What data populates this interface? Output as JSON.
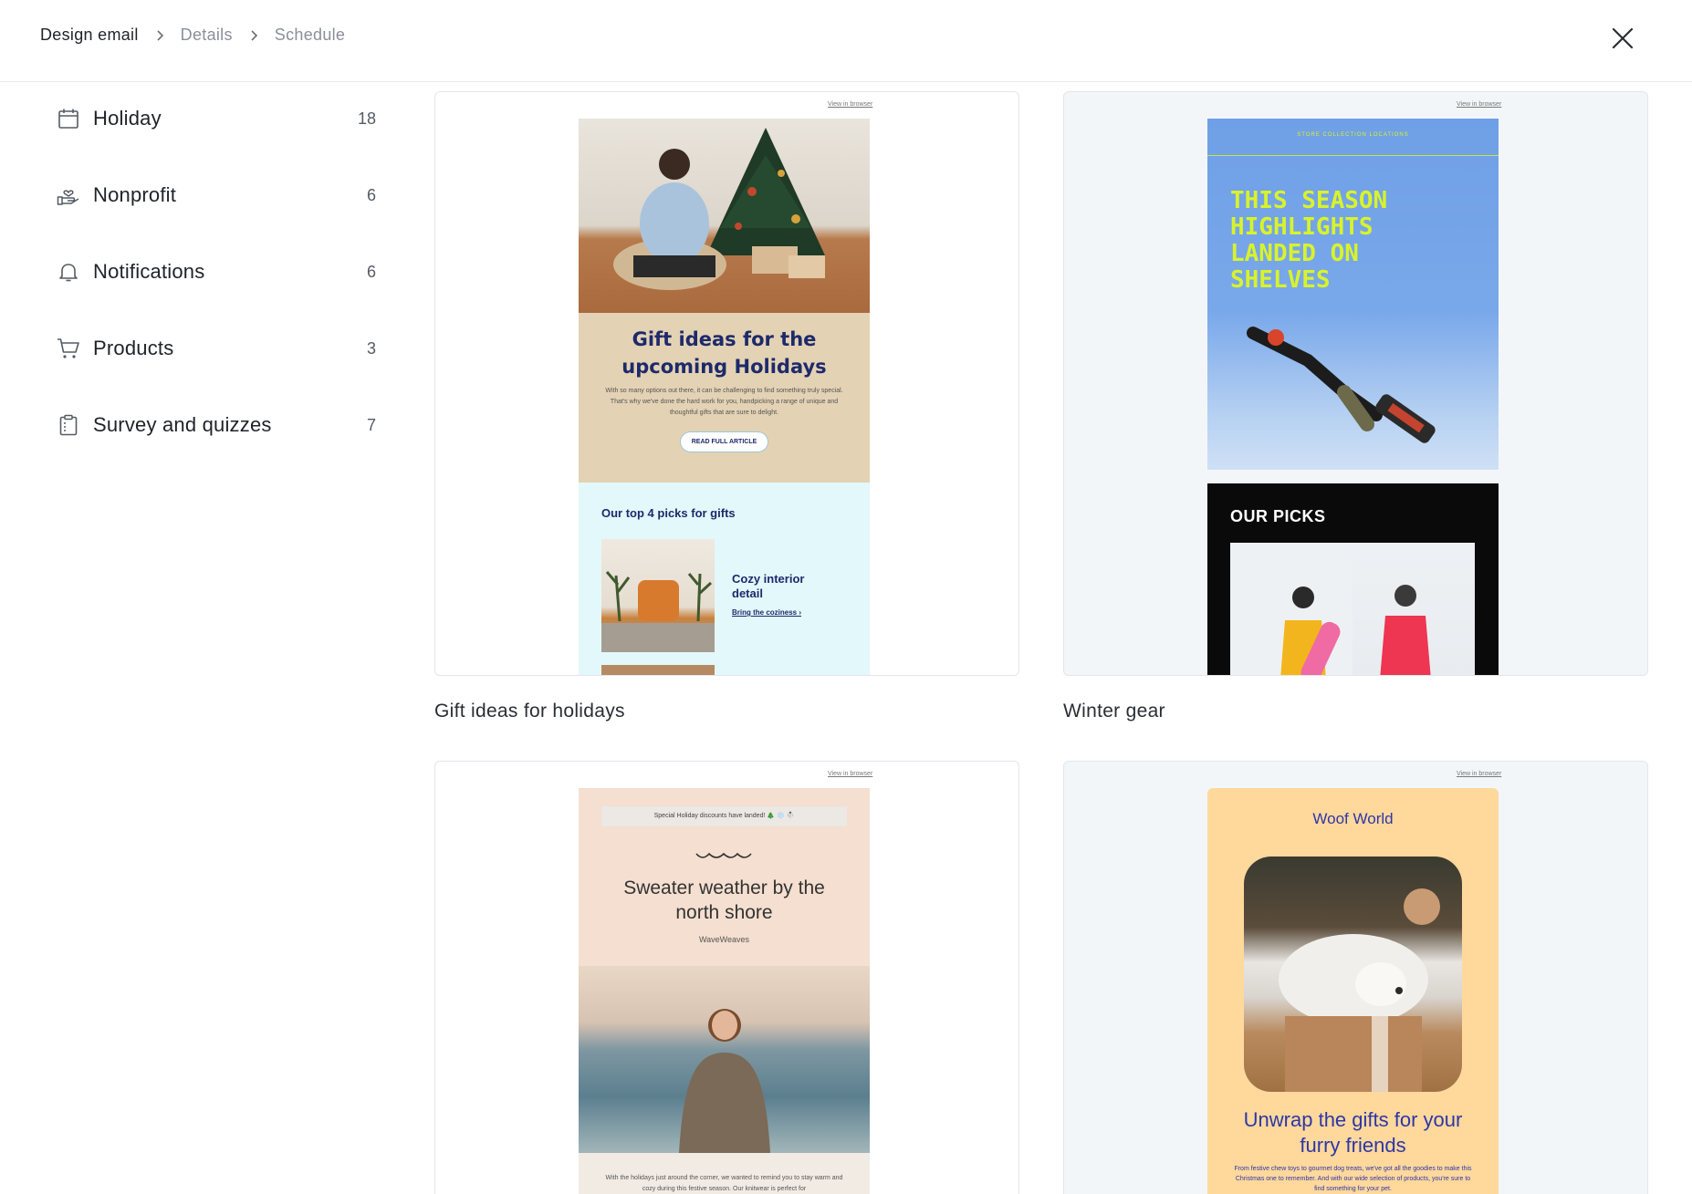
{
  "breadcrumb": {
    "steps": [
      {
        "label": "Design email",
        "active": true
      },
      {
        "label": "Details",
        "active": false
      },
      {
        "label": "Schedule",
        "active": false
      }
    ]
  },
  "sidebar": {
    "items": [
      {
        "label": "Holiday",
        "count": "18",
        "icon": "calendar-icon"
      },
      {
        "label": "Nonprofit",
        "count": "6",
        "icon": "hand-heart-icon"
      },
      {
        "label": "Notifications",
        "count": "6",
        "icon": "bell-icon"
      },
      {
        "label": "Products",
        "count": "3",
        "icon": "cart-icon"
      },
      {
        "label": "Survey and quizzes",
        "count": "7",
        "icon": "clipboard-icon"
      }
    ]
  },
  "templates": [
    {
      "title": "Gift ideas for holidays",
      "view_in_browser": "View in browser",
      "heading": "Gift ideas for the upcoming Holidays",
      "body": "With so many options out there, it can be challenging to find something truly special. That's why we've done the hard work for you, handpicking a range of unique and thoughtful gifts that are sure to delight.",
      "button": "READ FULL ARTICLE",
      "section_title": "Our top 4 picks for gifts",
      "item_title": "Cozy interior detail",
      "item_link": "Bring the coziness ›"
    },
    {
      "title": "Winter gear",
      "view_in_browser": "View in browser",
      "nav": "STORE   COLLECTION   LOCATIONS",
      "heading": "THIS SEASON HIGHLIGHTS LANDED ON SHELVES",
      "section_title": "OUR PICKS"
    },
    {
      "title": "",
      "view_in_browser": "View in browser",
      "banner": "Special Holiday discounts have landed! 🎄 ❄️ ☃️",
      "heading": "Sweater weather by the north shore",
      "brand": "WaveWeaves",
      "body": "With the holidays just around the corner, we wanted to remind you to stay warm and cozy during this festive season. Our knitwear is perfect for"
    },
    {
      "title": "",
      "view_in_browser": "View in browser",
      "brand": "Woof World",
      "heading": "Unwrap the gifts for your furry friends",
      "body": "From festive chew toys to gourmet dog treats, we've got all the goodies to make this Christmas one to remember. And with our wide selection of products, you're sure to find something for your pet."
    }
  ],
  "colors": {
    "accent_navy": "#1d2a6b",
    "neon_yellow": "#d8f32a",
    "woof_blue": "#2d37a8"
  }
}
